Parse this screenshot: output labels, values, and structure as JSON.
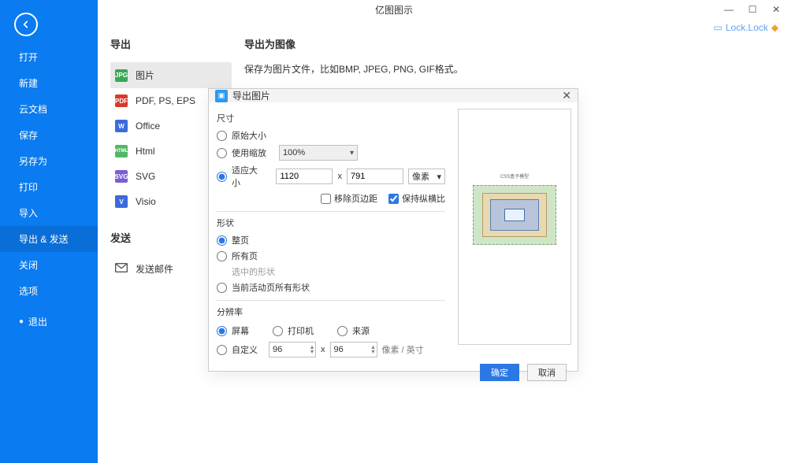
{
  "app": {
    "title": "亿图图示"
  },
  "user": {
    "name": "Lock.Lock"
  },
  "sidebar": {
    "items": [
      {
        "label": "打开"
      },
      {
        "label": "新建"
      },
      {
        "label": "云文档"
      },
      {
        "label": "保存"
      },
      {
        "label": "另存为"
      },
      {
        "label": "打印"
      },
      {
        "label": "导入"
      },
      {
        "label": "导出 & 发送"
      },
      {
        "label": "关闭"
      },
      {
        "label": "选项"
      },
      {
        "label": "退出"
      }
    ]
  },
  "export": {
    "title": "导出",
    "items": [
      {
        "label": "图片",
        "ico": "JPG",
        "color": "#3aa757"
      },
      {
        "label": "PDF, PS, EPS",
        "ico": "PDF",
        "color": "#d63b2b"
      },
      {
        "label": "Office",
        "ico": "W",
        "color": "#3b6bdc"
      },
      {
        "label": "Html",
        "ico": "HTML",
        "color": "#52b868"
      },
      {
        "label": "SVG",
        "ico": "SVG",
        "color": "#7a5ed4"
      },
      {
        "label": "Visio",
        "ico": "V",
        "color": "#3b6bdc"
      }
    ]
  },
  "send": {
    "title": "发送",
    "items": [
      {
        "label": "发送邮件"
      }
    ]
  },
  "detail": {
    "title": "导出为图像",
    "desc": "保存为图片文件，比如BMP, JPEG, PNG, GIF格式。"
  },
  "dialog": {
    "title": "导出图片",
    "size": {
      "title": "尺寸",
      "original": "原始大小",
      "scale": "使用缩放",
      "scale_value": "100%",
      "fit": "适应大小",
      "width": "1120",
      "height": "791",
      "times": "x",
      "unit": "像素",
      "unit_caret": "▾",
      "remove_margin": "移除页边距",
      "keep_ratio": "保持纵横比"
    },
    "shape": {
      "title": "形状",
      "full": "整页",
      "all": "所有页",
      "selected": "选中的形状",
      "current": "当前活动页所有形状"
    },
    "dpi": {
      "title": "分辨率",
      "screen": "屏幕",
      "printer": "打印机",
      "source": "来源",
      "custom": "自定义",
      "dpi_x": "96",
      "dpi_y": "96",
      "times": "x",
      "unit": "像素 / 英寸"
    },
    "preview_caption": "CSS盒子模型",
    "ok": "确定",
    "cancel": "取消"
  }
}
